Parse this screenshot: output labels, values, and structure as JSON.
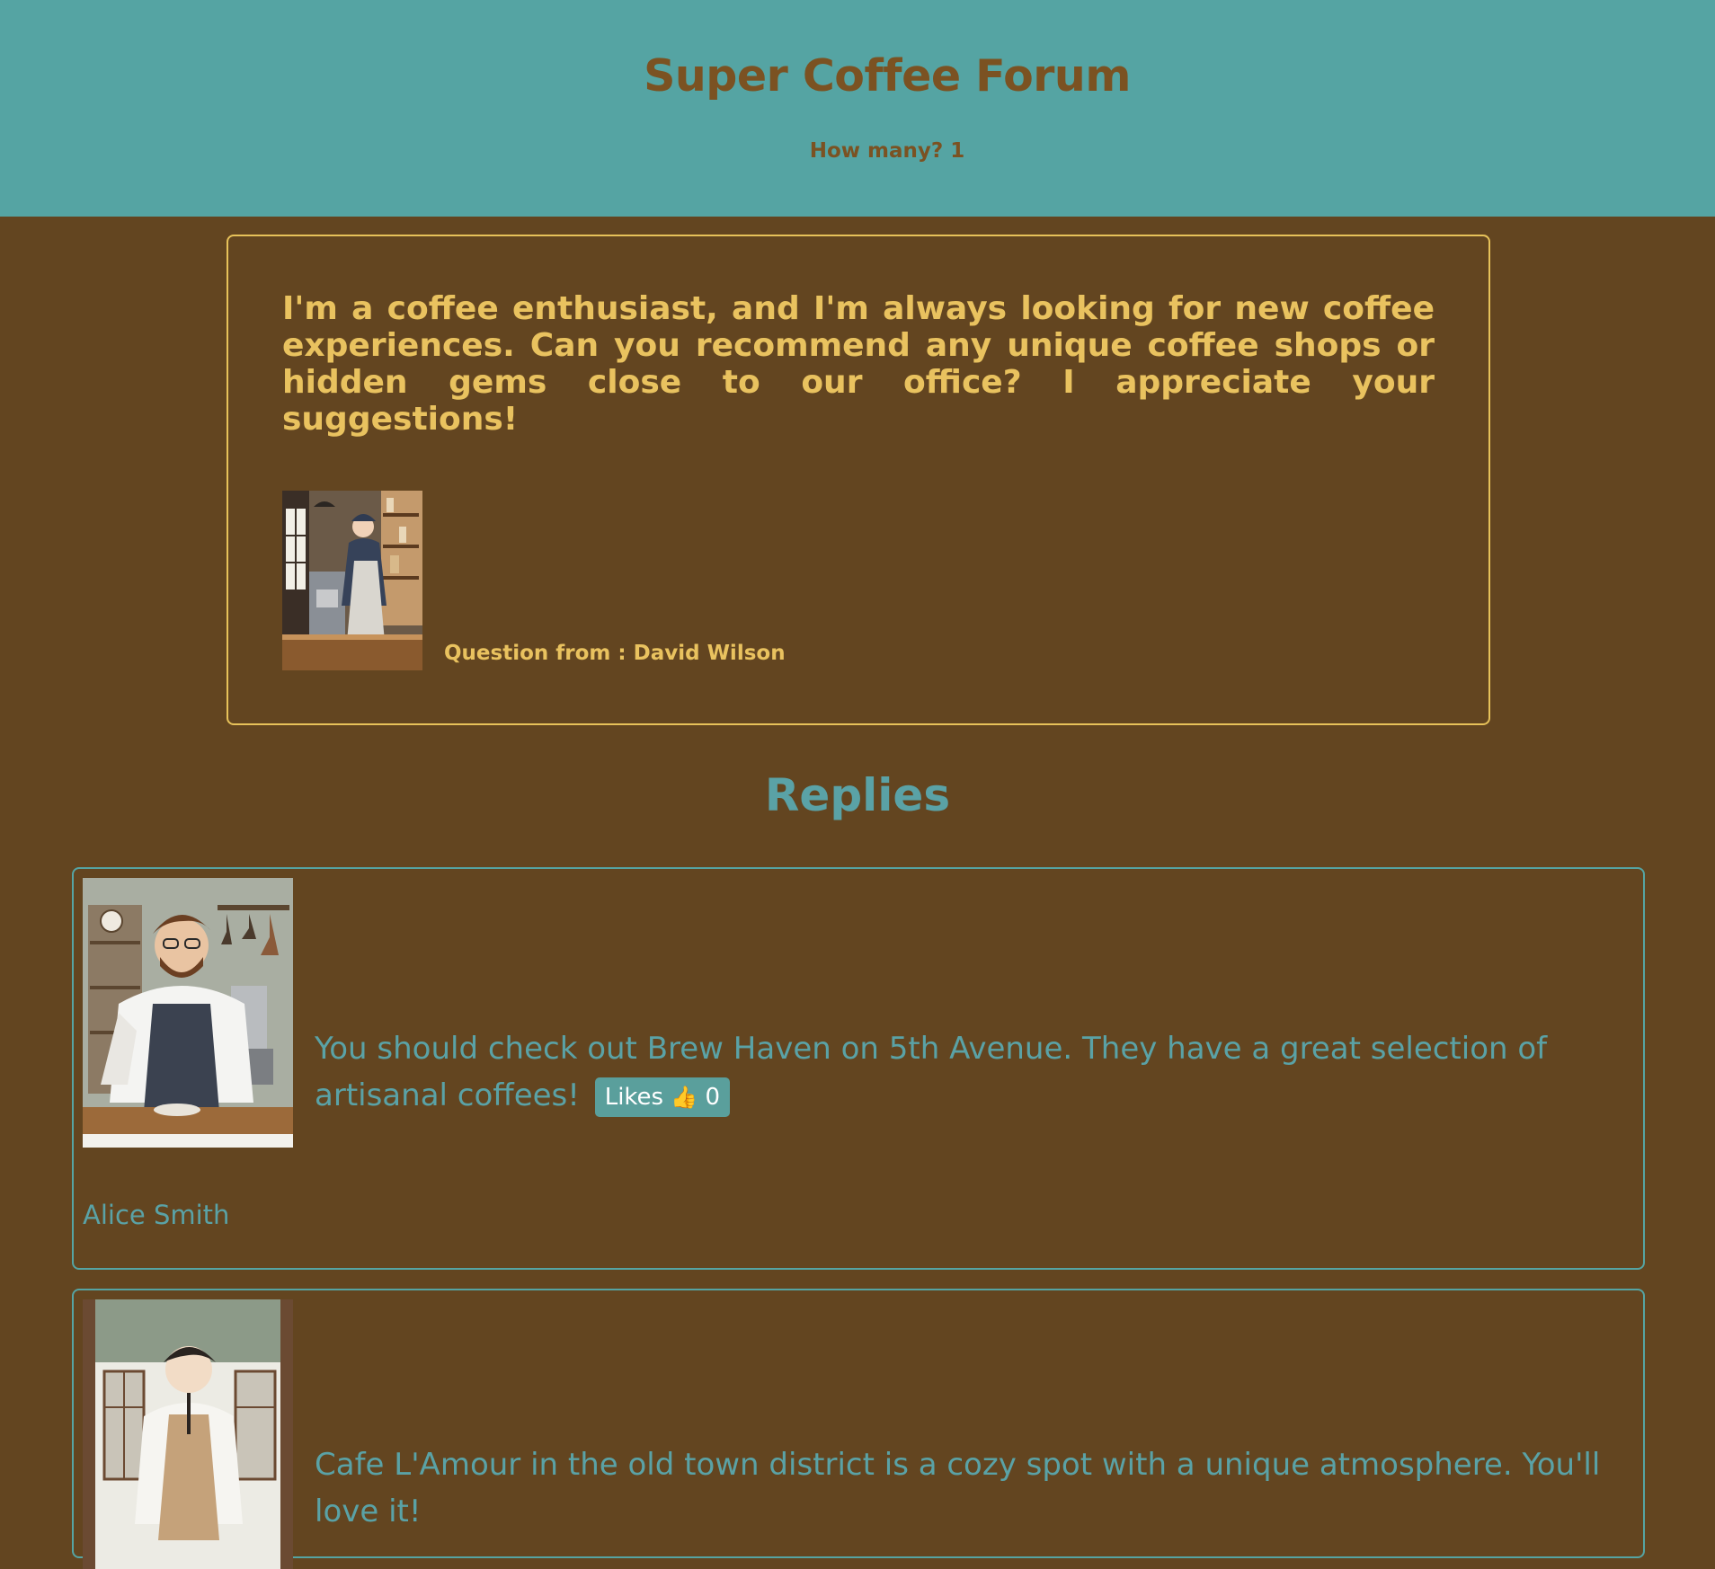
{
  "header": {
    "title": "Super Coffee Forum",
    "count_label": "How many? 1"
  },
  "question": {
    "text": "I'm a coffee enthusiast, and I'm always looking for new coffee experiences. Can you recommend any unique coffee shops or hidden gems close to our office? I appreciate your suggestions!",
    "from_label": "Question from : David Wilson"
  },
  "replies_heading": "Replies",
  "replies": [
    {
      "text": "You should check out Brew Haven on 5th Avenue. They have a great selection of artisanal coffees!",
      "likes_label": "Likes",
      "likes_icon": "thumbs-up-icon",
      "likes_count": "0",
      "author": "Alice Smith"
    },
    {
      "text": "Cafe L'Amour in the old town district is a cozy spot with a unique atmosphere. You'll love it!"
    }
  ],
  "colors": {
    "header_bg": "#55a4a3",
    "page_bg": "#634520",
    "title_color": "#7b5222",
    "question_accent": "#e9c25f",
    "reply_accent": "#5aa2a6"
  }
}
